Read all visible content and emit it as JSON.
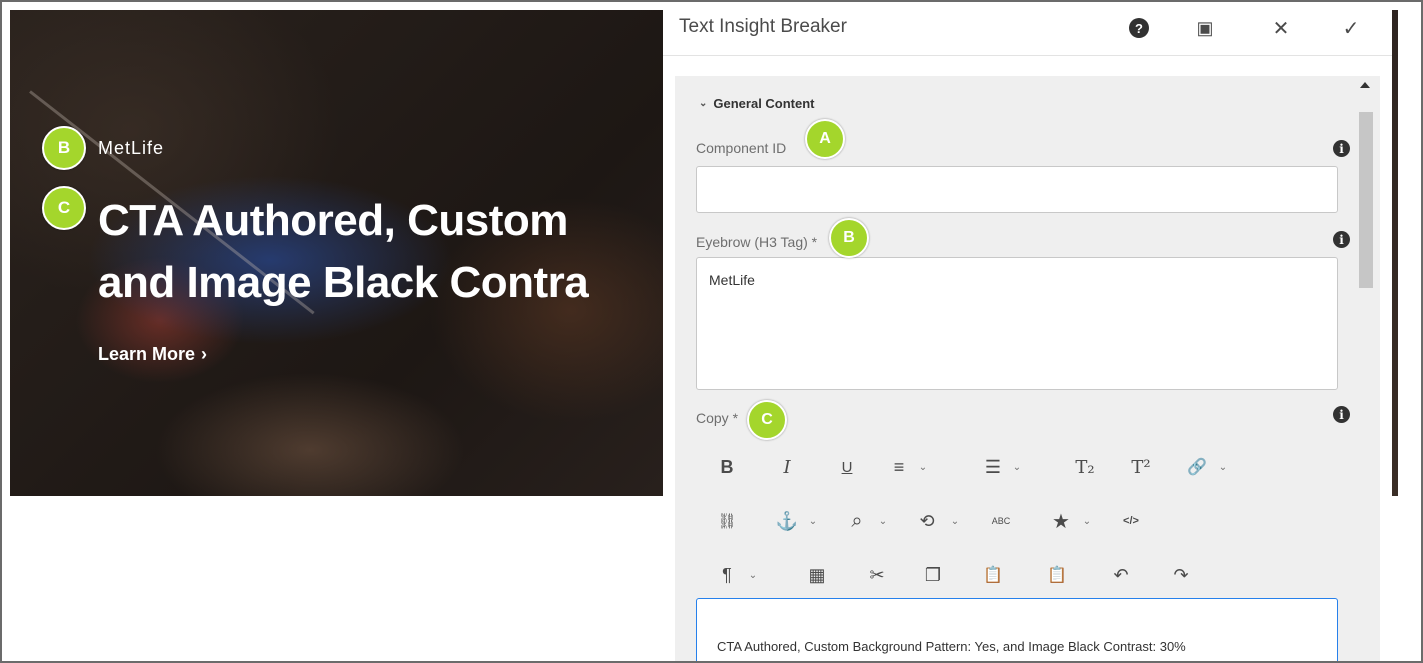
{
  "hero": {
    "eyebrow": "MetLife",
    "title_line1": "CTA Authored, Custom",
    "title_line2": "and Image Black Contra",
    "cta_label": "Learn More",
    "cta_chevron": "›"
  },
  "badges": {
    "a": "A",
    "b": "B",
    "c": "C"
  },
  "dialog": {
    "title": "Text Insight Breaker",
    "help_glyph": "?",
    "fullscreen_glyph": "▣",
    "close_glyph": "✕",
    "done_glyph": "✓",
    "section_label": "General Content",
    "section_chevron": "⌄",
    "fields": {
      "component_id": {
        "label": "Component ID",
        "value": ""
      },
      "eyebrow": {
        "label": "Eyebrow (H3 Tag) *",
        "value": "MetLife"
      },
      "copy": {
        "label": "Copy *",
        "value": "CTA Authored, Custom Background Pattern: Yes, and Image Black Contrast: 30%"
      }
    },
    "info_glyph": "i"
  },
  "rte_toolbar": {
    "row1": [
      "B",
      "I",
      "U",
      "≡",
      "☰",
      "T₂",
      "T²",
      "🔗"
    ],
    "row2": [
      "⛓",
      "⚓",
      "⌕",
      "⟲",
      "ABC",
      "★",
      "</>"
    ],
    "row3": [
      "¶",
      "▦",
      "✂",
      "❐",
      "📋",
      "📋",
      "↶",
      "↷"
    ],
    "caret": "⌄"
  },
  "colors": {
    "badge": "#a4d62c",
    "focus_border": "#2680eb",
    "panel_bg": "#efefef"
  }
}
